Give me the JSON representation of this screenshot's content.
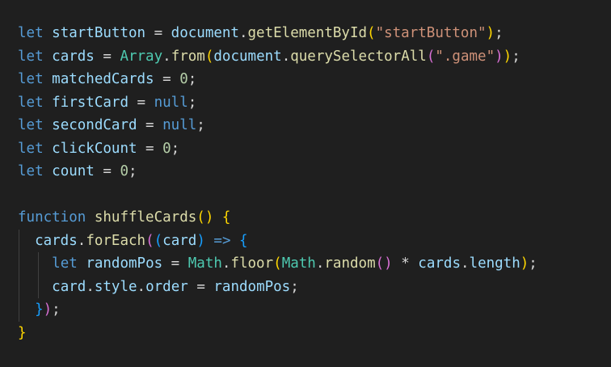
{
  "code": {
    "line1": {
      "kw": "let",
      "name": "startButton",
      "eq": " = ",
      "obj": "document",
      "dot": ".",
      "method": "getElementById",
      "open": "(",
      "arg": "\"startButton\"",
      "close": ")",
      "semi": ";"
    },
    "line2": {
      "kw": "let",
      "name": "cards",
      "eq": " = ",
      "cls": "Array",
      "dot": ".",
      "method": "from",
      "open": "(",
      "obj": "document",
      "dot2": ".",
      "method2": "querySelectorAll",
      "open2": "(",
      "arg": "\".game\"",
      "close2": ")",
      "close": ")",
      "semi": ";"
    },
    "line3": {
      "kw": "let",
      "name": "matchedCards",
      "eq": " = ",
      "value": "0",
      "semi": ";"
    },
    "line4": {
      "kw": "let",
      "name": "firstCard",
      "eq": " = ",
      "value": "null",
      "semi": ";"
    },
    "line5": {
      "kw": "let",
      "name": "secondCard",
      "eq": " = ",
      "value": "null",
      "semi": ";"
    },
    "line6": {
      "kw": "let",
      "name": "clickCount",
      "eq": " = ",
      "value": "0",
      "semi": ";"
    },
    "line7": {
      "kw": "let",
      "name": "count",
      "eq": " = ",
      "value": "0",
      "semi": ";"
    },
    "line9": {
      "kw": "function",
      "name": "shuffleCards",
      "parens": "()",
      "brace": "{"
    },
    "line10": {
      "obj": "cards",
      "dot": ".",
      "method": "forEach",
      "open": "(",
      "open2": "(",
      "param": "card",
      "close2": ")",
      "arrow": "=>",
      "brace": "{"
    },
    "line11": {
      "kw": "let",
      "name": "randomPos",
      "eq": " = ",
      "obj": "Math",
      "dot": ".",
      "method": "floor",
      "open": "(",
      "obj2": "Math",
      "dot2": ".",
      "method2": "random",
      "parens": "()",
      "mul": " * ",
      "obj3": "cards",
      "dot3": ".",
      "prop": "length",
      "close": ")",
      "semi": ";"
    },
    "line12": {
      "obj": "card",
      "dot": ".",
      "prop": "style",
      "dot2": ".",
      "prop2": "order",
      "eq": " = ",
      "value": "randomPos",
      "semi": ";"
    },
    "line13": {
      "brace": "}",
      "paren": ")",
      "semi": ";"
    },
    "line14": {
      "brace": "}"
    }
  }
}
